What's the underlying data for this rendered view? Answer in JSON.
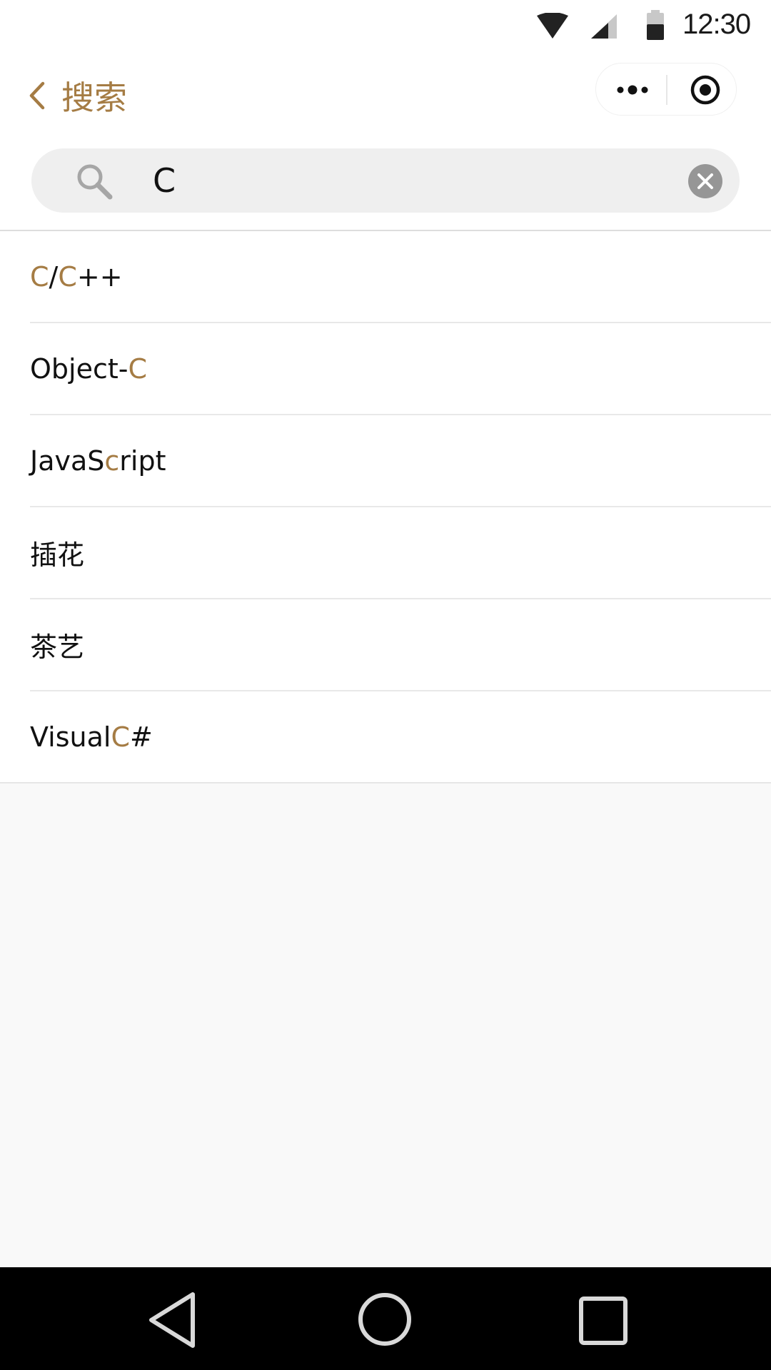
{
  "status_bar": {
    "time": "12:30",
    "icons": [
      "wifi-icon",
      "cellular-signal-icon",
      "battery-icon"
    ]
  },
  "header": {
    "back_icon": "chevron-left-icon",
    "title": "搜索",
    "capsule": {
      "more_icon": "more-dots-icon",
      "close_icon": "target-circle-icon"
    }
  },
  "search": {
    "icon": "search-icon",
    "value": "C",
    "clear_icon": "clear-circle-icon"
  },
  "results": [
    [
      {
        "t": "C",
        "hl": true
      },
      {
        "t": "/",
        "hl": false
      },
      {
        "t": "C",
        "hl": true
      },
      {
        "t": "++",
        "hl": false
      }
    ],
    [
      {
        "t": "Object-",
        "hl": false
      },
      {
        "t": "C",
        "hl": true
      }
    ],
    [
      {
        "t": "JavaS",
        "hl": false
      },
      {
        "t": "c",
        "hl": true
      },
      {
        "t": "ript",
        "hl": false
      }
    ],
    [
      {
        "t": "插花",
        "hl": false
      }
    ],
    [
      {
        "t": "茶艺",
        "hl": false
      }
    ],
    [
      {
        "t": "Visual ",
        "hl": false
      },
      {
        "t": "C",
        "hl": true
      },
      {
        "t": "#",
        "hl": false
      }
    ]
  ],
  "navigation_bar": {
    "icons": [
      "back-triangle-icon",
      "home-circle-icon",
      "recents-square-icon"
    ]
  },
  "colors": {
    "accent": "#a57c44",
    "text": "#111111",
    "search_bg": "#efefef",
    "page_bg": "#f9f9f9",
    "nav_bg": "#000000"
  }
}
